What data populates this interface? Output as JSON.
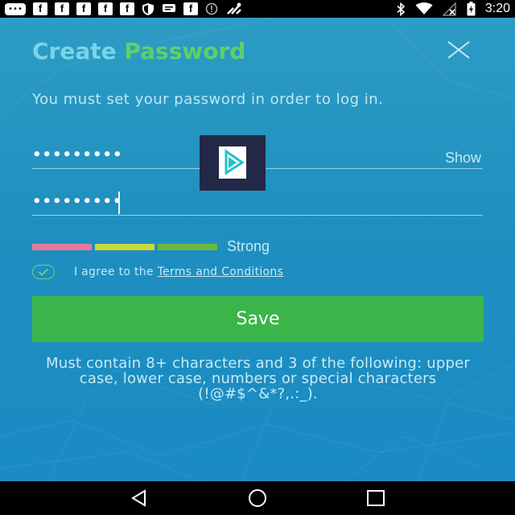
{
  "status_bar": {
    "icons_left": [
      "message-icon",
      "facebook-icon",
      "facebook-icon",
      "facebook-icon",
      "facebook-icon",
      "facebook-icon",
      "shield-icon",
      "sms-icon",
      "facebook-icon",
      "alert-icon",
      "vpn-icon"
    ],
    "icons_right": [
      "bluetooth-icon",
      "wifi-icon",
      "no-signal-icon",
      "battery-icon"
    ],
    "time": "3:20"
  },
  "header": {
    "title_part1": "Create",
    "title_part2": "Password",
    "title_color1": "#79d4e8",
    "title_color2": "#5fcf6a"
  },
  "subtitle": "You must set your password in order to log in.",
  "password_field": {
    "value": "•••••••••",
    "show_label": "Show"
  },
  "confirm_field": {
    "value": "•••••••••"
  },
  "strength": {
    "label": "Strong",
    "segments": [
      {
        "color": "#e57a9a"
      },
      {
        "color": "#c9d83a"
      },
      {
        "color": "#6cb83f"
      }
    ]
  },
  "agreement": {
    "checked": true,
    "prefix": "I agree to the",
    "link_text": "Terms and Conditions"
  },
  "save_button": {
    "label": "Save",
    "color": "#3bb54a"
  },
  "hint": "Must contain 8+ characters and 3 of the following: upper case, lower case, numbers or special characters (!@#$^&*?,.:_).",
  "nav_bar": {
    "buttons": [
      "back-icon",
      "home-icon",
      "recents-icon"
    ]
  }
}
